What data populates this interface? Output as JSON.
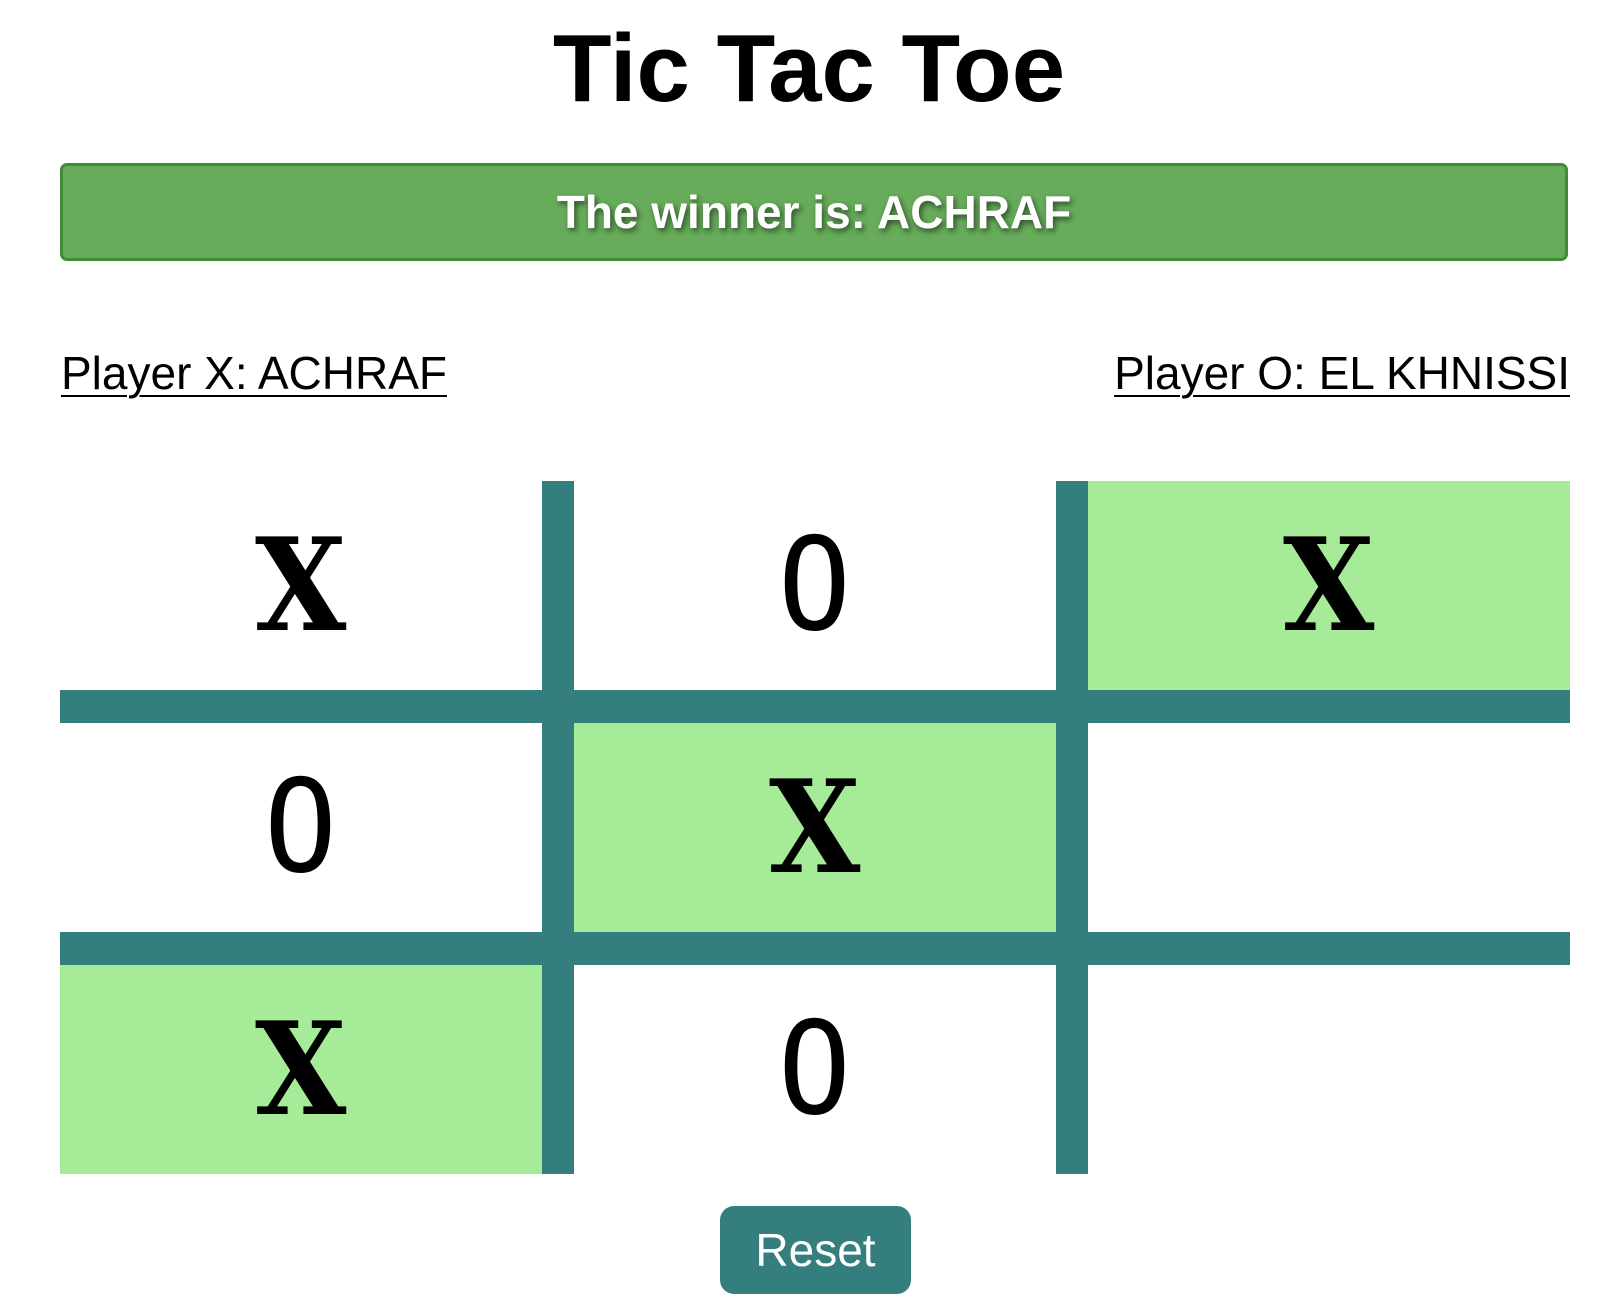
{
  "title": "Tic Tac Toe",
  "status": {
    "winner_text": "The winner is: ACHRAF"
  },
  "players": {
    "x_label": "Player X: ACHRAF",
    "o_label": "Player O: EL KHNISSI"
  },
  "board": {
    "cells": [
      {
        "mark": "X",
        "winning": false
      },
      {
        "mark": "O",
        "winning": false
      },
      {
        "mark": "X",
        "winning": true
      },
      {
        "mark": "O",
        "winning": false
      },
      {
        "mark": "X",
        "winning": true
      },
      {
        "mark": "",
        "winning": false
      },
      {
        "mark": "X",
        "winning": true
      },
      {
        "mark": "O",
        "winning": false
      },
      {
        "mark": "",
        "winning": false
      }
    ]
  },
  "reset_label": "Reset",
  "colors": {
    "banner_bg": "#67ac5b",
    "grid_lines": "#357e7e",
    "winning_cell": "#a6eb97",
    "reset_bg": "#357e7e"
  }
}
